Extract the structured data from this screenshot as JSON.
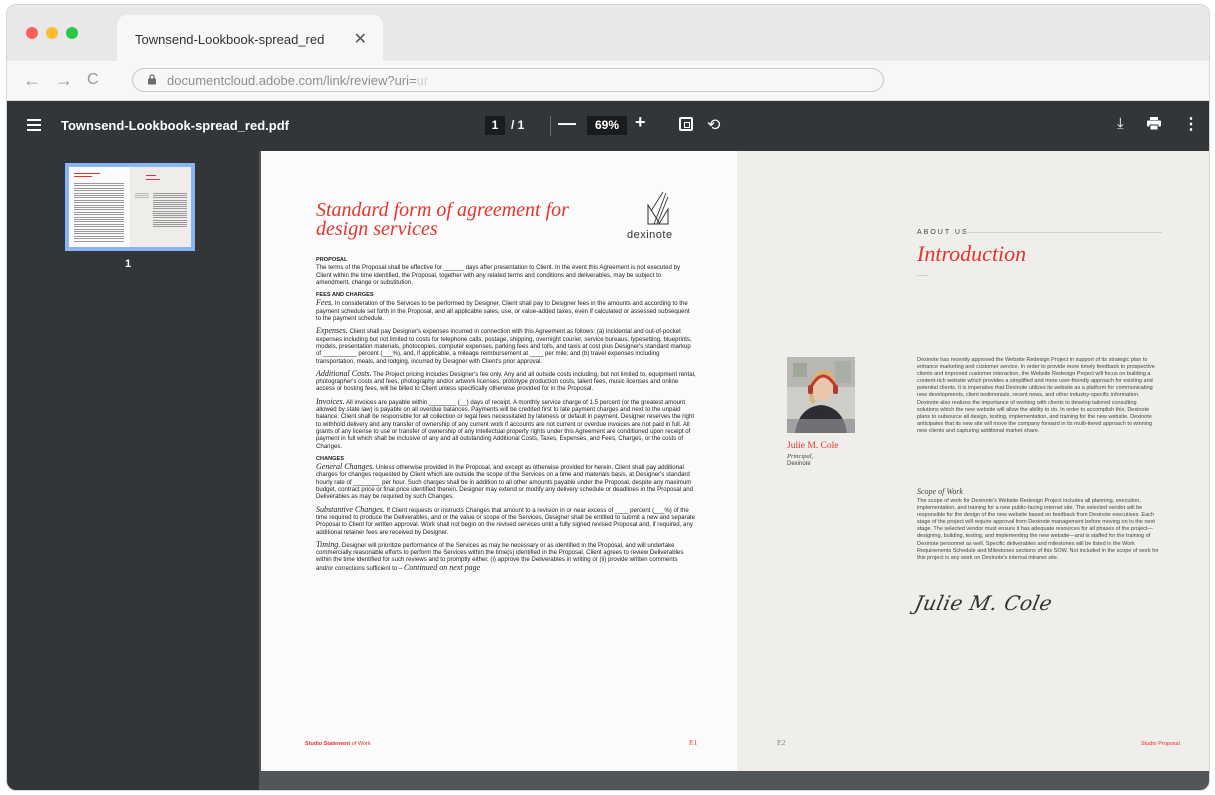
{
  "browser": {
    "tab_title": "Townsend-Lookbook-spread_red",
    "tab_close": "✕",
    "back": "←",
    "forward": "→",
    "reload": "C",
    "url": "documentcloud.adobe.com/link/review?uri=",
    "url_fade": "ur"
  },
  "toolbar": {
    "menu_icon": "hamburger-icon",
    "doc_title": "Townsend-Lookbook-spread_red.pdf",
    "current_page": "1",
    "page_total": "/ 1",
    "zoom_out": "—",
    "zoom_level": "69%",
    "zoom_in": "+",
    "fit_icon": "fit-page-icon",
    "rotate": "⟲",
    "download": "⤓",
    "print_icon": "print-icon",
    "more": "⋮"
  },
  "sidebar": {
    "thumbnail_label": "1"
  },
  "left_page": {
    "title": "Standard form of agreement for design services",
    "logo_word": "dexinote",
    "sections": [
      {
        "heading": "PROPOSAL",
        "text": "The terms of the Proposal shall be effective for ______ days after presentation to Client. In the event this Agreement is not executed by Client within the time identified, the Proposal, together with any related terms and conditions and deliverables, may be subject to amendment, change or substitution."
      },
      {
        "heading": "FEES AND CHARGES",
        "lead": "Fees.",
        "text": " In consideration of the Services to be performed by Designer, Client shall pay to Designer fees in the amounts and according to the payment schedule set forth in the Proposal, and all applicable sales, use, or value-added taxes, even if calculated or assessed subsequent to the payment schedule."
      },
      {
        "lead": "Expenses.",
        "text": " Client shall pay Designer's expenses incurred in connection with this Agreement as follows: (a) incidental and out-of-pocket expenses including but not limited to costs for telephone calls, postage, shipping, overnight courier, service bureaus, typesetting, blueprints, models, presentation materials, photocopies, computer expenses, parking fees and tolls, and taxis at cost plus Designer's standard markup of __________ percent (___%), and, if applicable, a mileage reimbursement at ____ per mile; and (b) travel expenses including transportation, meals, and lodging, incurred by Designer with Client's prior approval."
      },
      {
        "lead": "Additional Costs.",
        "text": " The Project pricing includes Designer's fee only. Any and all outside costs including, but not limited to, equipment rental, photographer's costs and fees, photography and/or artwork licenses, prototype production costs, talent fees, music licenses and online access or hosting fees, will be billed to Client unless specifically otherwise provided for in the Proposal."
      },
      {
        "lead": "Invoices.",
        "text": " All invoices are payable within ________ (__) days of receipt. A monthly service charge of 1.5 percent (or the greatest amount allowed by state law) is payable on all overdue balances. Payments will be credited first to late payment charges and next to the unpaid balance. Client shall be responsible for all collection or legal fees necessitated by lateness or default in payment. Designer reserves the right to withhold delivery and any transfer of ownership of any current work if accounts are not current or overdue invoices are not paid in full. All grants of any license to use or transfer of ownership of any intellectual property rights under this Agreement are conditioned upon receipt of payment in full which shall be inclusive of any and all outstanding Additional Costs, Taxes, Expenses, and Fees, Charges, or the costs of Changes."
      },
      {
        "heading": "CHANGES",
        "lead": "General Changes.",
        "text": " Unless otherwise provided in the Proposal, and except as otherwise provided for herein, Client shall pay additional charges for changes requested by Client which are outside the scope of the Services on a time and materials basis, at Designer's standard hourly rate of ________ per hour. Such charges shall be in addition to all other amounts payable under the Proposal, despite any maximum budget, contract price or final price identified therein. Designer may extend or modify any delivery schedule or deadlines in the Proposal and Deliverables as may be required by such Changes."
      },
      {
        "lead": "Substantive Changes.",
        "text": " If Client requests or instructs Changes that amount to a revision in or near excess of ____ percent (___%) of the time required to produce the Deliverables, and or the value or scope of the Services, Designer shall be entitled to submit a new and separate Proposal to Client for written approval. Work shall not begin on the revised services until a fully signed revised Proposal and, if required, any additional retainer fees are received by Designer."
      },
      {
        "lead": "Timing.",
        "text": " Designer will prioritize performance of the Services as may be necessary or as identified in the Proposal, and will undertake commercially reasonable efforts to perform the Services within the time(s) identified in the Proposal. Client agrees to review Deliverables within the time identified for such reviews and to promptly either, (i) approve the Deliverables in writing or (ii) provide written comments and/or corrections sufficient to – ",
        "tail": "Continued on next page"
      }
    ],
    "footer_brand_bold": "Studio Statement",
    "footer_brand_rest": " of Work",
    "footer_page": "P.1"
  },
  "right_page": {
    "about_label": "ABOUT US",
    "intro_title": "Introduction",
    "person_name": "Julie M. Cole",
    "person_role": "Principal,",
    "person_org": "Dexinote",
    "intro_text": "Dexinote has recently approved the Website Redesign Project in support of its strategic plan to enhance marketing and customer service. In order to provide more timely feedback to prospective clients and improved customer interaction, the Website Redesign Project will focus on building a content-rich website which provides a simplified and more user-friendly approach for existing and potential clients. It is imperative that Dexinote utilizes its website as a platform for communicating new developments, client testimonials, recent news, and other industry-specific information. Dexinote also realizes the importance of working with clients to develop tailored consulting solutions which the new website will allow the ability to do. In order to accomplish this, Dexinote plans to outsource all design, testing, implementation, and training for the new website. Dexinote anticipates that its new site will move the company forward in its multi-tiered approach to winning new clients and capturing additional market share.",
    "scope_title": "Scope of Work",
    "scope_text": "The scope of work for Dexinote's Website Redesign Project includes all planning, execution, implementation, and training for a new public-facing internet site. The selected vendor will be responsible for the design of the new website based on feedback from Dexinote executives. Each stage of the project will require approval from Dexinote management before moving on to the next stage. The selected vendor must ensure it has adequate resources for all phases of the project—designing, building, testing, and implementing the new website—and is staffed for the training of Dexinote personnel as well. Specific deliverables and milestones will be listed in the Work Requirements Schedule and Milestones sections of this SOW. Not included in the scope of work for this project is any work on Dexinote's internal intranet site.",
    "signature": "Julie M. Cole",
    "footer_page": "P.2",
    "footer_brand": "Studio Proposal"
  }
}
